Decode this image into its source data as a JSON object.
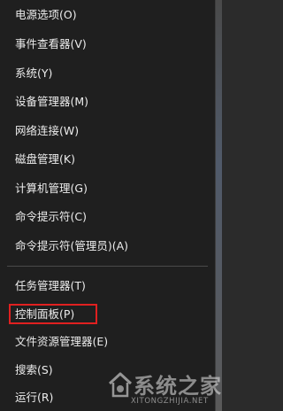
{
  "menu": {
    "group1": [
      {
        "label": "电源选项(O)"
      },
      {
        "label": "事件查看器(V)"
      },
      {
        "label": "系统(Y)"
      },
      {
        "label": "设备管理器(M)"
      },
      {
        "label": "网络连接(W)"
      },
      {
        "label": "磁盘管理(K)"
      },
      {
        "label": "计算机管理(G)"
      },
      {
        "label": "命令提示符(C)"
      },
      {
        "label": "命令提示符(管理员)(A)"
      }
    ],
    "group2": [
      {
        "label": "任务管理器(T)"
      },
      {
        "label": "控制面板(P)"
      },
      {
        "label": "文件资源管理器(E)"
      },
      {
        "label": "搜索(S)"
      },
      {
        "label": "运行(R)"
      }
    ],
    "highlighted_item": "控制面板(P)"
  },
  "watermark": {
    "title": "系统之家",
    "url": "XITONGZHIJIA.NET",
    "icon": "house-logo-icon"
  },
  "colors": {
    "menu_background": "#1f1f1f",
    "menu_text": "#ececec",
    "highlight_border": "#e02020"
  }
}
